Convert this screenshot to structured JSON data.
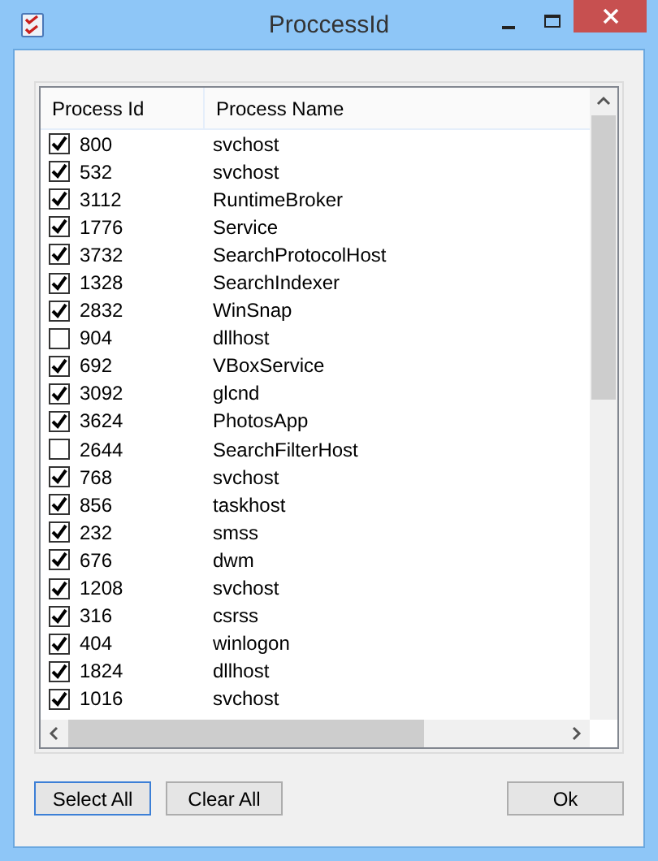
{
  "window": {
    "title": "ProccessId"
  },
  "table": {
    "columns": [
      "Process Id",
      "Process Name"
    ],
    "rows": [
      {
        "id": "800",
        "name": "svchost",
        "checked": true
      },
      {
        "id": "532",
        "name": "svchost",
        "checked": true
      },
      {
        "id": "3112",
        "name": "RuntimeBroker",
        "checked": true
      },
      {
        "id": "1776",
        "name": "Service",
        "checked": true
      },
      {
        "id": "3732",
        "name": "SearchProtocolHost",
        "checked": true
      },
      {
        "id": "1328",
        "name": "SearchIndexer",
        "checked": true
      },
      {
        "id": "2832",
        "name": "WinSnap",
        "checked": true
      },
      {
        "id": "904",
        "name": "dllhost",
        "checked": false
      },
      {
        "id": "692",
        "name": "VBoxService",
        "checked": true
      },
      {
        "id": "3092",
        "name": "glcnd",
        "checked": true
      },
      {
        "id": "3624",
        "name": "PhotosApp",
        "checked": true
      },
      {
        "id": "2644",
        "name": "SearchFilterHost",
        "checked": false
      },
      {
        "id": "768",
        "name": "svchost",
        "checked": true
      },
      {
        "id": "856",
        "name": "taskhost",
        "checked": true
      },
      {
        "id": "232",
        "name": "smss",
        "checked": true
      },
      {
        "id": "676",
        "name": "dwm",
        "checked": true
      },
      {
        "id": "1208",
        "name": "svchost",
        "checked": true
      },
      {
        "id": "316",
        "name": "csrss",
        "checked": true
      },
      {
        "id": "404",
        "name": "winlogon",
        "checked": true
      },
      {
        "id": "1824",
        "name": "dllhost",
        "checked": true
      },
      {
        "id": "1016",
        "name": "svchost",
        "checked": true
      }
    ]
  },
  "buttons": [
    {
      "label": "Select All",
      "focused": true
    },
    {
      "label": "Clear All",
      "focused": false
    },
    {
      "label": "Ok",
      "focused": false
    }
  ]
}
